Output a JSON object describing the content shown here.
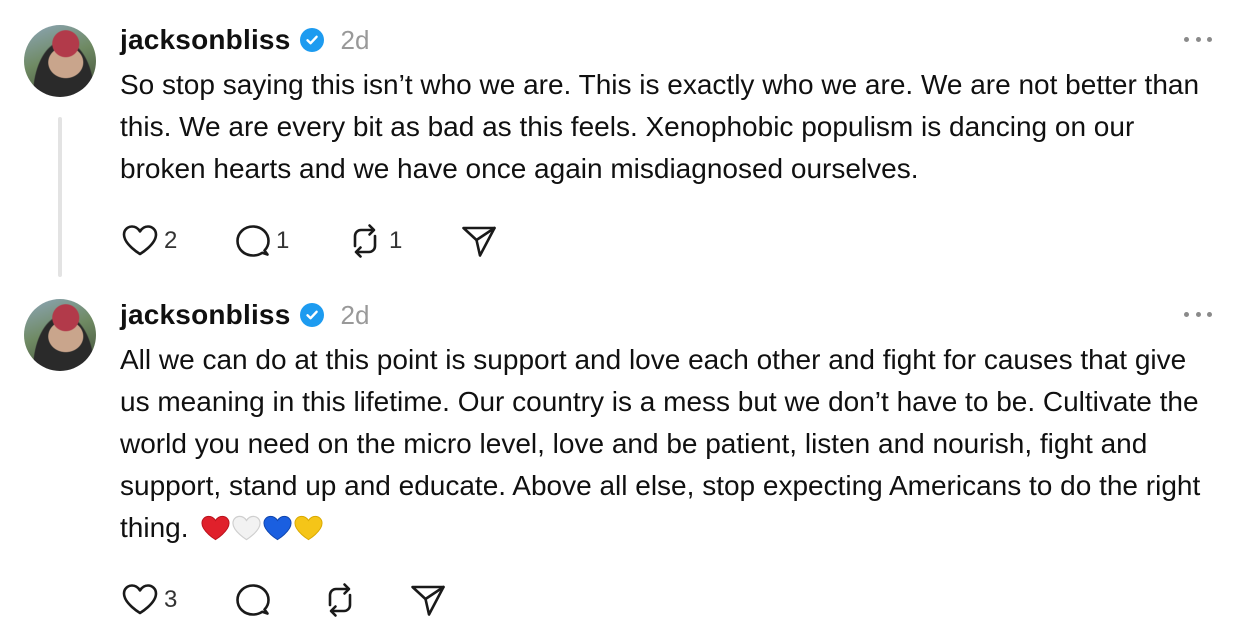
{
  "posts": [
    {
      "username": "jacksonbliss",
      "timestamp": "2d",
      "text": "So stop saying this isn’t who we are. This is exactly who we are. We are not better than this. We are every bit as bad as this feels. Xenophobic populism is dancing on our broken hearts and we have once again misdiagnosed ourselves.",
      "emojis": [],
      "counts": {
        "likes": "2",
        "replies": "1",
        "reposts": "1"
      }
    },
    {
      "username": "jacksonbliss",
      "timestamp": "2d",
      "text": "All we can do at this point is support and love each other and fight for causes that give us meaning in this lifetime. Our country is a mess but we don’t have to be. Cultivate the world you need on the micro level, love and be patient, listen and nourish, fight and support, stand up and educate. Above all else, stop expecting Americans to do the right thing.",
      "emojis": [
        "red-heart",
        "white-heart",
        "blue-heart",
        "yellow-heart"
      ],
      "counts": {
        "likes": "3",
        "replies": "",
        "reposts": ""
      }
    }
  ],
  "icons": {
    "like": "heart-outline-icon",
    "reply": "speech-bubble-icon",
    "repost": "repost-arrows-icon",
    "share": "paper-plane-icon",
    "more": "more-dots-icon",
    "verified": "verified-badge-icon"
  },
  "colors": {
    "verified": "#1d9bf0",
    "timestamp": "#999999",
    "thread_line": "#e3e3e3",
    "red_heart": "#e0202b",
    "white_heart": "#f2f2f2",
    "blue_heart": "#1a5fe0",
    "yellow_heart": "#f5c518"
  }
}
